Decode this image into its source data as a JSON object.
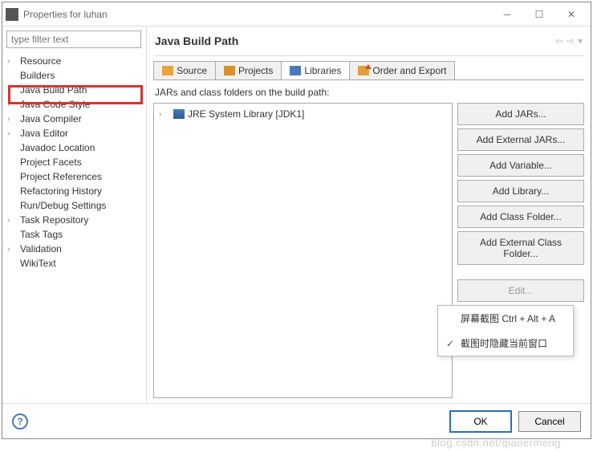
{
  "window": {
    "title": "Properties for luhan"
  },
  "filter": {
    "placeholder": "type filter text"
  },
  "tree": {
    "items": [
      {
        "label": "Resource",
        "expandable": true
      },
      {
        "label": "Builders",
        "expandable": false
      },
      {
        "label": "Java Build Path",
        "expandable": false,
        "selected": true,
        "highlighted": true
      },
      {
        "label": "Java Code Style",
        "expandable": true
      },
      {
        "label": "Java Compiler",
        "expandable": true
      },
      {
        "label": "Java Editor",
        "expandable": true
      },
      {
        "label": "Javadoc Location",
        "expandable": false
      },
      {
        "label": "Project Facets",
        "expandable": false
      },
      {
        "label": "Project References",
        "expandable": false
      },
      {
        "label": "Refactoring History",
        "expandable": false
      },
      {
        "label": "Run/Debug Settings",
        "expandable": false
      },
      {
        "label": "Task Repository",
        "expandable": true
      },
      {
        "label": "Task Tags",
        "expandable": false
      },
      {
        "label": "Validation",
        "expandable": true
      },
      {
        "label": "WikiText",
        "expandable": false
      }
    ]
  },
  "page": {
    "title": "Java Build Path"
  },
  "tabs": [
    {
      "label": "Source",
      "icon": "source"
    },
    {
      "label": "Projects",
      "icon": "projects"
    },
    {
      "label": "Libraries",
      "icon": "libraries",
      "active": true
    },
    {
      "label": "Order and Export",
      "icon": "order"
    }
  ],
  "libraries": {
    "subtext": "JARs and class folders on the build path:",
    "items": [
      {
        "label": "JRE System Library [JDK1]",
        "expandable": true
      }
    ]
  },
  "side_buttons": {
    "add_jars": "Add JARs...",
    "add_external_jars": "Add External JARs...",
    "add_variable": "Add Variable...",
    "add_library": "Add Library...",
    "add_class_folder": "Add Class Folder...",
    "add_external_class_folder": "Add External Class Folder...",
    "edit": "Edit..."
  },
  "footer": {
    "ok": "OK",
    "cancel": "Cancel"
  },
  "popup": {
    "item1": "屏幕截图 Ctrl + Alt + A",
    "item2": "截图时隐藏当前窗口"
  },
  "watermark": "blog.csdn.net/qiaoermeng"
}
